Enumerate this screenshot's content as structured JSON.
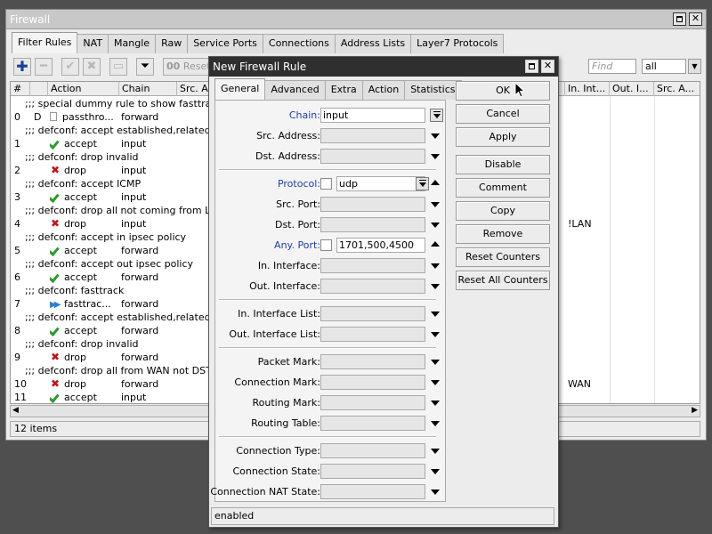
{
  "main_window": {
    "title": "Firewall",
    "tabs": [
      {
        "label": "Filter Rules",
        "active": true
      },
      {
        "label": "NAT"
      },
      {
        "label": "Mangle"
      },
      {
        "label": "Raw"
      },
      {
        "label": "Service Ports"
      },
      {
        "label": "Connections"
      },
      {
        "label": "Address Lists"
      },
      {
        "label": "Layer7 Protocols"
      }
    ],
    "toolbar": {
      "reset_label": "Reset C",
      "reset_prefix": "00",
      "find_placeholder": "Find",
      "filter_value": "all"
    },
    "columns": [
      "#",
      "",
      "Action",
      "Chain",
      "Src. Ad",
      "In. Int...",
      "Out. I...",
      "Src. A..."
    ],
    "rows": [
      {
        "type": "comment",
        "text": ";;; special dummy rule to show fasttrack co"
      },
      {
        "num": "0",
        "flag": "D",
        "action": "passthro...",
        "icon": "doc",
        "chain": "forward"
      },
      {
        "type": "comment",
        "text": ";;; defconf: accept established,related,unt"
      },
      {
        "num": "1",
        "action": "accept",
        "icon": "check",
        "chain": "input"
      },
      {
        "type": "comment",
        "text": ";;; defconf: drop invalid"
      },
      {
        "num": "2",
        "action": "drop",
        "icon": "x",
        "chain": "input"
      },
      {
        "type": "comment",
        "text": ";;; defconf: accept ICMP"
      },
      {
        "num": "3",
        "action": "accept",
        "icon": "check",
        "chain": "input"
      },
      {
        "type": "comment",
        "text": ";;; defconf: drop all not coming from LAN"
      },
      {
        "num": "4",
        "action": "drop",
        "icon": "x",
        "chain": "input",
        "in_int": "!LAN"
      },
      {
        "type": "comment",
        "text": ";;; defconf: accept in ipsec policy"
      },
      {
        "num": "5",
        "action": "accept",
        "icon": "check",
        "chain": "forward"
      },
      {
        "type": "comment",
        "text": ";;; defconf: accept out ipsec policy"
      },
      {
        "num": "6",
        "action": "accept",
        "icon": "check",
        "chain": "forward"
      },
      {
        "type": "comment",
        "text": ";;; defconf: fasttrack"
      },
      {
        "num": "7",
        "action": "fasttrac...",
        "icon": "ff",
        "chain": "forward"
      },
      {
        "type": "comment",
        "text": ";;; defconf: accept established,related, unt"
      },
      {
        "num": "8",
        "action": "accept",
        "icon": "check",
        "chain": "forward"
      },
      {
        "type": "comment",
        "text": ";;; defconf: drop invalid"
      },
      {
        "num": "9",
        "action": "drop",
        "icon": "x",
        "chain": "forward"
      },
      {
        "type": "comment",
        "text": ";;; defconf:  drop all from WAN not DSTNAT"
      },
      {
        "num": "10",
        "action": "drop",
        "icon": "x",
        "chain": "forward",
        "in_int": "WAN"
      },
      {
        "num": "11",
        "action": "accept",
        "icon": "check",
        "chain": "input"
      }
    ],
    "status": "12 items"
  },
  "dialog": {
    "title": "New Firewall Rule",
    "tabs": [
      {
        "label": "General",
        "active": true
      },
      {
        "label": "Advanced"
      },
      {
        "label": "Extra"
      },
      {
        "label": "Action"
      },
      {
        "label": "Statistics"
      }
    ],
    "fields": {
      "chain": {
        "label": "Chain:",
        "value": "input"
      },
      "src_address": {
        "label": "Src. Address:",
        "value": ""
      },
      "dst_address": {
        "label": "Dst. Address:",
        "value": ""
      },
      "protocol": {
        "label": "Protocol:",
        "value": "udp"
      },
      "src_port": {
        "label": "Src. Port:",
        "value": ""
      },
      "dst_port": {
        "label": "Dst. Port:",
        "value": ""
      },
      "any_port": {
        "label": "Any. Port:",
        "value": "1701,500,4500"
      },
      "in_interface": {
        "label": "In. Interface:",
        "value": ""
      },
      "out_interface": {
        "label": "Out. Interface:",
        "value": ""
      },
      "in_interface_list": {
        "label": "In. Interface List:",
        "value": ""
      },
      "out_interface_list": {
        "label": "Out. Interface List:",
        "value": ""
      },
      "packet_mark": {
        "label": "Packet Mark:",
        "value": ""
      },
      "connection_mark": {
        "label": "Connection Mark:",
        "value": ""
      },
      "routing_mark": {
        "label": "Routing Mark:",
        "value": ""
      },
      "routing_table": {
        "label": "Routing Table:",
        "value": ""
      },
      "connection_type": {
        "label": "Connection Type:",
        "value": ""
      },
      "connection_state": {
        "label": "Connection State:",
        "value": ""
      },
      "connection_nat_state": {
        "label": "Connection NAT State:",
        "value": ""
      }
    },
    "buttons": {
      "ok": "OK",
      "cancel": "Cancel",
      "apply": "Apply",
      "disable": "Disable",
      "comment": "Comment",
      "copy": "Copy",
      "remove": "Remove",
      "reset_counters": "Reset Counters",
      "reset_all_counters": "Reset All Counters"
    },
    "status": "enabled"
  },
  "colors": {
    "accent_label": "#1d3fa6",
    "accept": "#2d9a2d",
    "drop": "#c0141a"
  }
}
